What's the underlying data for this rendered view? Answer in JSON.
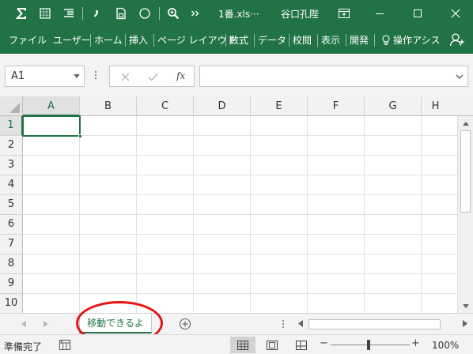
{
  "title_bar": {
    "document_name": "1番.xls···",
    "user_name": "谷口孔陛",
    "quick_access_icons": [
      "autosum-icon",
      "table-icon",
      "format-icon",
      "comma-style-icon",
      "save-icon",
      "circle-icon",
      "zoom-icon",
      "more-commands-icon"
    ],
    "window_controls": [
      "ribbon-display-icon",
      "minimize-icon",
      "maximize-icon",
      "close-icon"
    ]
  },
  "ribbon": {
    "tabs": [
      "ファイル",
      "ユーザー",
      "ホーム",
      "挿入",
      "ページ レイアウト",
      "数式",
      "データ",
      "校閲",
      "表示",
      "開発"
    ],
    "tell_me": "操作アシス",
    "share_icon": "share-icon"
  },
  "formula_bar": {
    "name_box": "A1",
    "fx_label": "fx",
    "formula_value": ""
  },
  "grid": {
    "columns": [
      "A",
      "B",
      "C",
      "D",
      "E",
      "F",
      "G",
      "H"
    ],
    "rows": [
      "1",
      "2",
      "3",
      "4",
      "5",
      "6",
      "7",
      "8",
      "9",
      "10"
    ],
    "selected_cell": "A1"
  },
  "sheets": {
    "tabs": [
      "移動できるよ"
    ],
    "active": "移動できるよ"
  },
  "status_bar": {
    "status": "準備完了",
    "views": [
      "normal-view-icon",
      "page-layout-view-icon",
      "page-break-preview-icon"
    ],
    "zoom_minus": "−",
    "zoom_plus": "+",
    "zoom_level": "100%"
  },
  "colors": {
    "accent": "#217346",
    "annotation": "#e41414"
  }
}
